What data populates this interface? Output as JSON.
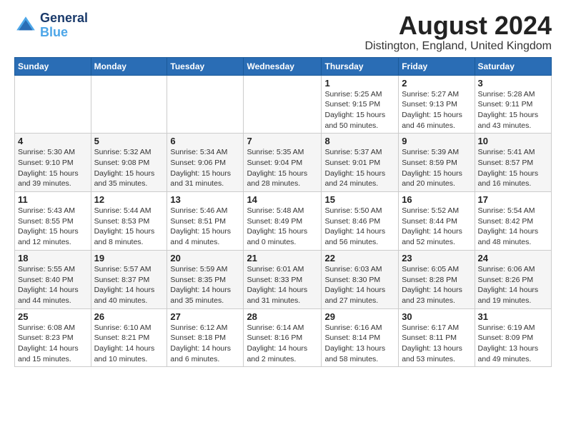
{
  "logo": {
    "line1": "General",
    "line2": "Blue"
  },
  "title": "August 2024",
  "subtitle": "Distington, England, United Kingdom",
  "days_of_week": [
    "Sunday",
    "Monday",
    "Tuesday",
    "Wednesday",
    "Thursday",
    "Friday",
    "Saturday"
  ],
  "weeks": [
    [
      {
        "num": "",
        "info": ""
      },
      {
        "num": "",
        "info": ""
      },
      {
        "num": "",
        "info": ""
      },
      {
        "num": "",
        "info": ""
      },
      {
        "num": "1",
        "info": "Sunrise: 5:25 AM\nSunset: 9:15 PM\nDaylight: 15 hours\nand 50 minutes."
      },
      {
        "num": "2",
        "info": "Sunrise: 5:27 AM\nSunset: 9:13 PM\nDaylight: 15 hours\nand 46 minutes."
      },
      {
        "num": "3",
        "info": "Sunrise: 5:28 AM\nSunset: 9:11 PM\nDaylight: 15 hours\nand 43 minutes."
      }
    ],
    [
      {
        "num": "4",
        "info": "Sunrise: 5:30 AM\nSunset: 9:10 PM\nDaylight: 15 hours\nand 39 minutes."
      },
      {
        "num": "5",
        "info": "Sunrise: 5:32 AM\nSunset: 9:08 PM\nDaylight: 15 hours\nand 35 minutes."
      },
      {
        "num": "6",
        "info": "Sunrise: 5:34 AM\nSunset: 9:06 PM\nDaylight: 15 hours\nand 31 minutes."
      },
      {
        "num": "7",
        "info": "Sunrise: 5:35 AM\nSunset: 9:04 PM\nDaylight: 15 hours\nand 28 minutes."
      },
      {
        "num": "8",
        "info": "Sunrise: 5:37 AM\nSunset: 9:01 PM\nDaylight: 15 hours\nand 24 minutes."
      },
      {
        "num": "9",
        "info": "Sunrise: 5:39 AM\nSunset: 8:59 PM\nDaylight: 15 hours\nand 20 minutes."
      },
      {
        "num": "10",
        "info": "Sunrise: 5:41 AM\nSunset: 8:57 PM\nDaylight: 15 hours\nand 16 minutes."
      }
    ],
    [
      {
        "num": "11",
        "info": "Sunrise: 5:43 AM\nSunset: 8:55 PM\nDaylight: 15 hours\nand 12 minutes."
      },
      {
        "num": "12",
        "info": "Sunrise: 5:44 AM\nSunset: 8:53 PM\nDaylight: 15 hours\nand 8 minutes."
      },
      {
        "num": "13",
        "info": "Sunrise: 5:46 AM\nSunset: 8:51 PM\nDaylight: 15 hours\nand 4 minutes."
      },
      {
        "num": "14",
        "info": "Sunrise: 5:48 AM\nSunset: 8:49 PM\nDaylight: 15 hours\nand 0 minutes."
      },
      {
        "num": "15",
        "info": "Sunrise: 5:50 AM\nSunset: 8:46 PM\nDaylight: 14 hours\nand 56 minutes."
      },
      {
        "num": "16",
        "info": "Sunrise: 5:52 AM\nSunset: 8:44 PM\nDaylight: 14 hours\nand 52 minutes."
      },
      {
        "num": "17",
        "info": "Sunrise: 5:54 AM\nSunset: 8:42 PM\nDaylight: 14 hours\nand 48 minutes."
      }
    ],
    [
      {
        "num": "18",
        "info": "Sunrise: 5:55 AM\nSunset: 8:40 PM\nDaylight: 14 hours\nand 44 minutes."
      },
      {
        "num": "19",
        "info": "Sunrise: 5:57 AM\nSunset: 8:37 PM\nDaylight: 14 hours\nand 40 minutes."
      },
      {
        "num": "20",
        "info": "Sunrise: 5:59 AM\nSunset: 8:35 PM\nDaylight: 14 hours\nand 35 minutes."
      },
      {
        "num": "21",
        "info": "Sunrise: 6:01 AM\nSunset: 8:33 PM\nDaylight: 14 hours\nand 31 minutes."
      },
      {
        "num": "22",
        "info": "Sunrise: 6:03 AM\nSunset: 8:30 PM\nDaylight: 14 hours\nand 27 minutes."
      },
      {
        "num": "23",
        "info": "Sunrise: 6:05 AM\nSunset: 8:28 PM\nDaylight: 14 hours\nand 23 minutes."
      },
      {
        "num": "24",
        "info": "Sunrise: 6:06 AM\nSunset: 8:26 PM\nDaylight: 14 hours\nand 19 minutes."
      }
    ],
    [
      {
        "num": "25",
        "info": "Sunrise: 6:08 AM\nSunset: 8:23 PM\nDaylight: 14 hours\nand 15 minutes."
      },
      {
        "num": "26",
        "info": "Sunrise: 6:10 AM\nSunset: 8:21 PM\nDaylight: 14 hours\nand 10 minutes."
      },
      {
        "num": "27",
        "info": "Sunrise: 6:12 AM\nSunset: 8:18 PM\nDaylight: 14 hours\nand 6 minutes."
      },
      {
        "num": "28",
        "info": "Sunrise: 6:14 AM\nSunset: 8:16 PM\nDaylight: 14 hours\nand 2 minutes."
      },
      {
        "num": "29",
        "info": "Sunrise: 6:16 AM\nSunset: 8:14 PM\nDaylight: 13 hours\nand 58 minutes."
      },
      {
        "num": "30",
        "info": "Sunrise: 6:17 AM\nSunset: 8:11 PM\nDaylight: 13 hours\nand 53 minutes."
      },
      {
        "num": "31",
        "info": "Sunrise: 6:19 AM\nSunset: 8:09 PM\nDaylight: 13 hours\nand 49 minutes."
      }
    ]
  ]
}
